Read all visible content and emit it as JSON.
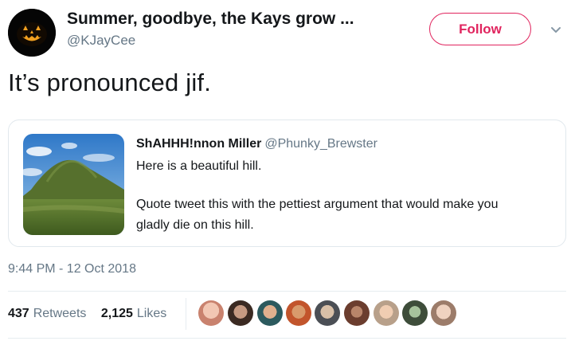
{
  "author": {
    "display_name": "Summer, goodbye, the Kays grow ...",
    "handle": "@KJayCee",
    "avatar": "jack-o-lantern-avatar"
  },
  "follow_label": "Follow",
  "caret_icon": "chevron-down-icon",
  "tweet_text": "It’s pronounced jif.",
  "quoted": {
    "name": "ShAHHH!nnon Miller",
    "handle": "@Phunky_Brewster",
    "line1": "Here is a beautiful hill.",
    "line2": "Quote tweet this with the pettiest argument that would make you",
    "line3": "gladly die on this hill.",
    "image": "green-hill-photo"
  },
  "timestamp": "9:44 PM - 12 Oct 2018",
  "stats": {
    "retweets_count": "437",
    "retweets_label": "Retweets",
    "likes_count": "2,125",
    "likes_label": "Likes"
  },
  "colors": {
    "follow": "#e0245e",
    "text": "#14171a",
    "muted": "#657786",
    "border": "#e1e8ed"
  }
}
